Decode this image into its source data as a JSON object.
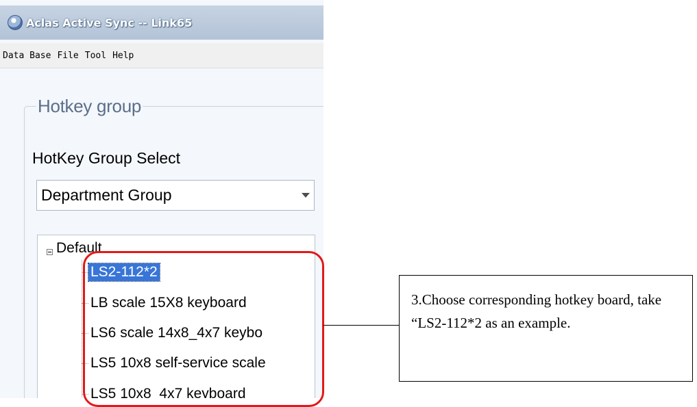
{
  "window": {
    "title": "Aclas Active Sync -- Link65",
    "icon": "app-logo-icon"
  },
  "menu": [
    "Data Base",
    "File",
    "Tool",
    "Help"
  ],
  "hotkey_group": {
    "legend": "Hotkey group",
    "select_label": "HotKey Group Select",
    "select_value": "Department Group"
  },
  "tree": {
    "root": "Default",
    "children": [
      "LS2-112*2",
      "LB scale 15X8 keyboard",
      "LS6 scale 14x8_4x7 keybo",
      "LS5 10x8 self-service scale",
      "LS5 10x8_4x7 keyboard"
    ],
    "selected_index": 0
  },
  "callout": {
    "text": "3.Choose corresponding hotkey board, take “LS2-112*2 as an example."
  },
  "colors": {
    "highlight": "#e21818",
    "selection": "#3875d7"
  }
}
